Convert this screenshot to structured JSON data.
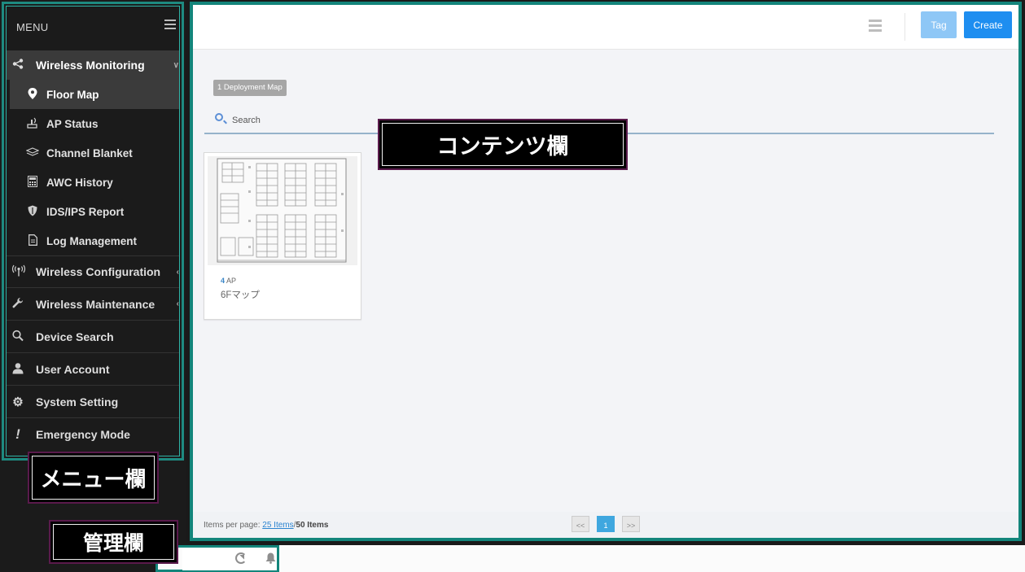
{
  "menu": {
    "title": "MENU",
    "groups": [
      {
        "label": "Wireless Monitoring",
        "icon": "share-icon",
        "expanded": true,
        "items": [
          {
            "label": "Floor Map",
            "icon": "map-pin-icon",
            "active": true
          },
          {
            "label": "AP Status",
            "icon": "ap-status-icon"
          },
          {
            "label": "Channel Blanket",
            "icon": "layers-icon"
          },
          {
            "label": "AWC History",
            "icon": "calculator-icon"
          },
          {
            "label": "IDS/IPS Report",
            "icon": "shield-icon"
          },
          {
            "label": "Log Management",
            "icon": "document-icon"
          }
        ]
      },
      {
        "label": "Wireless Configuration",
        "icon": "antenna-icon"
      },
      {
        "label": "Wireless Maintenance",
        "icon": "wrench-icon"
      },
      {
        "label": "Device Search",
        "icon": "search-icon"
      },
      {
        "label": "User Account",
        "icon": "user-icon"
      },
      {
        "label": "System Setting",
        "icon": "gear-icon"
      },
      {
        "label": "Emergency Mode",
        "icon": "exclamation-icon"
      }
    ]
  },
  "annotations": {
    "menu_area": "メニュー欄",
    "content_area": "コンテンツ欄",
    "management_area": "管理欄"
  },
  "toolbar": {
    "tag_label": "Tag",
    "create_label": "Create",
    "list_view_icon": "list-view-icon"
  },
  "content": {
    "count_badge": "1 Deployment Map",
    "search_placeholder": "Search",
    "maps": [
      {
        "ap_count": "4",
        "ap_unit": "AP",
        "name": "6Fマップ"
      }
    ]
  },
  "pagination": {
    "items_per_page_label": "Items per page:",
    "per_page": "25 Items",
    "separator": "/",
    "total": "50 Items",
    "first": "<<",
    "current": "1",
    "next": ">>"
  },
  "management": {
    "refresh_icon": "refresh-icon",
    "bell_icon": "bell-icon"
  },
  "colors": {
    "accent": "#1e8ef0",
    "frame": "#13857b",
    "sidebar": "#1b1b1b"
  }
}
